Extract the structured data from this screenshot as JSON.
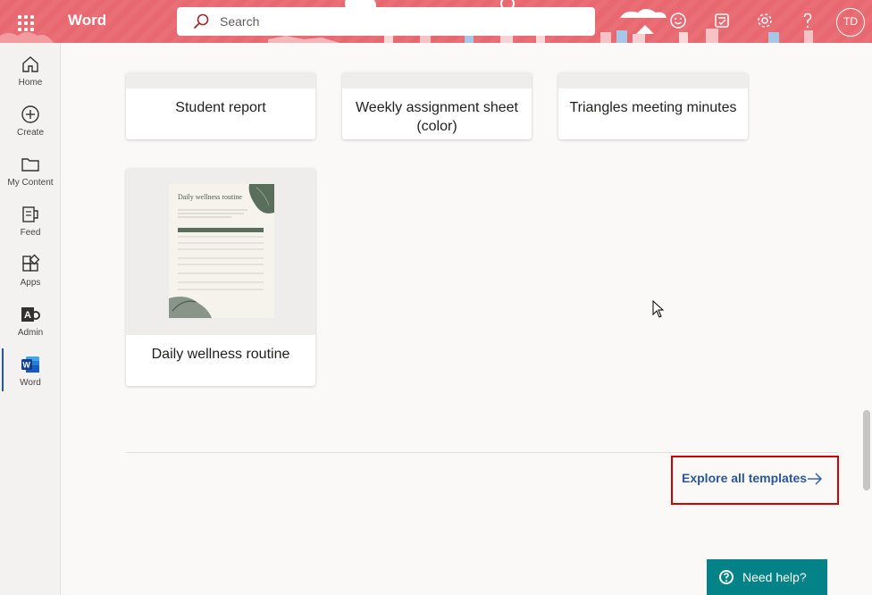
{
  "header": {
    "app_name": "Word",
    "search_placeholder": "Search",
    "avatar_initials": "TD",
    "bg_color": "#e8686f"
  },
  "rail": {
    "items": [
      {
        "label": "Home",
        "icon": "home-icon"
      },
      {
        "label": "Create",
        "icon": "create-icon"
      },
      {
        "label": "My Content",
        "icon": "folder-icon"
      },
      {
        "label": "Feed",
        "icon": "feed-icon"
      },
      {
        "label": "Apps",
        "icon": "apps-icon"
      },
      {
        "label": "Admin",
        "icon": "admin-icon"
      },
      {
        "label": "Word",
        "icon": "word-icon",
        "active": true
      }
    ]
  },
  "templates": {
    "row1": [
      {
        "title": "Student report"
      },
      {
        "title": "Weekly assignment sheet (color)"
      },
      {
        "title": "Triangles meeting minutes"
      }
    ],
    "row2": [
      {
        "title": "Daily wellness routine"
      }
    ],
    "thumbnail": {
      "heading": "Daily wellness routine"
    }
  },
  "explore": {
    "label": "Explore all templates"
  },
  "help": {
    "label": "Need help?",
    "color": "#038387"
  }
}
